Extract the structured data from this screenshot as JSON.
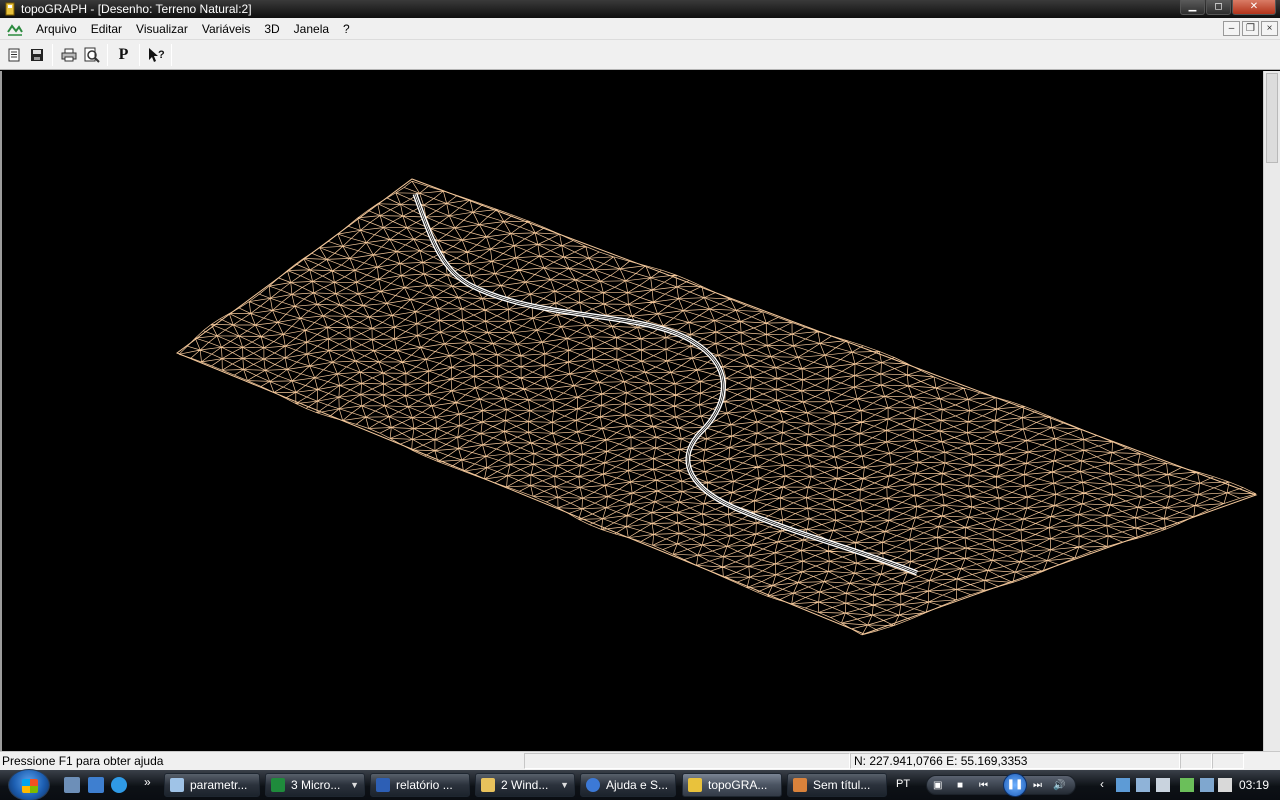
{
  "window": {
    "title": "topoGRAPH - [Desenho: Terreno Natural:2]",
    "buttons": [
      "minimize-icon",
      "maximize-icon",
      "close-icon"
    ]
  },
  "menu": {
    "items": [
      "Arquivo",
      "Editar",
      "Visualizar",
      "Variáveis",
      "3D",
      "Janela",
      "?"
    ]
  },
  "toolbar": {
    "buttons": [
      "list-icon",
      "save-icon",
      "print-icon",
      "print-preview-icon",
      "P",
      "context-help-icon"
    ]
  },
  "colors": {
    "mesh": "#f3c79a",
    "road": "#ffffff",
    "canvas_bg": "#000000"
  },
  "status": {
    "help_text": "Pressione F1 para obter ajuda",
    "coords": "N: 227.941,0766 E: 55.169,3353"
  },
  "taskbar": {
    "tasks": [
      "parametr...",
      "3 Micro...",
      "relatório ...",
      "2 Wind...",
      "Ajuda e S...",
      "topoGRA...",
      "Sem títul..."
    ],
    "language": "PT",
    "clock": "03:19"
  }
}
